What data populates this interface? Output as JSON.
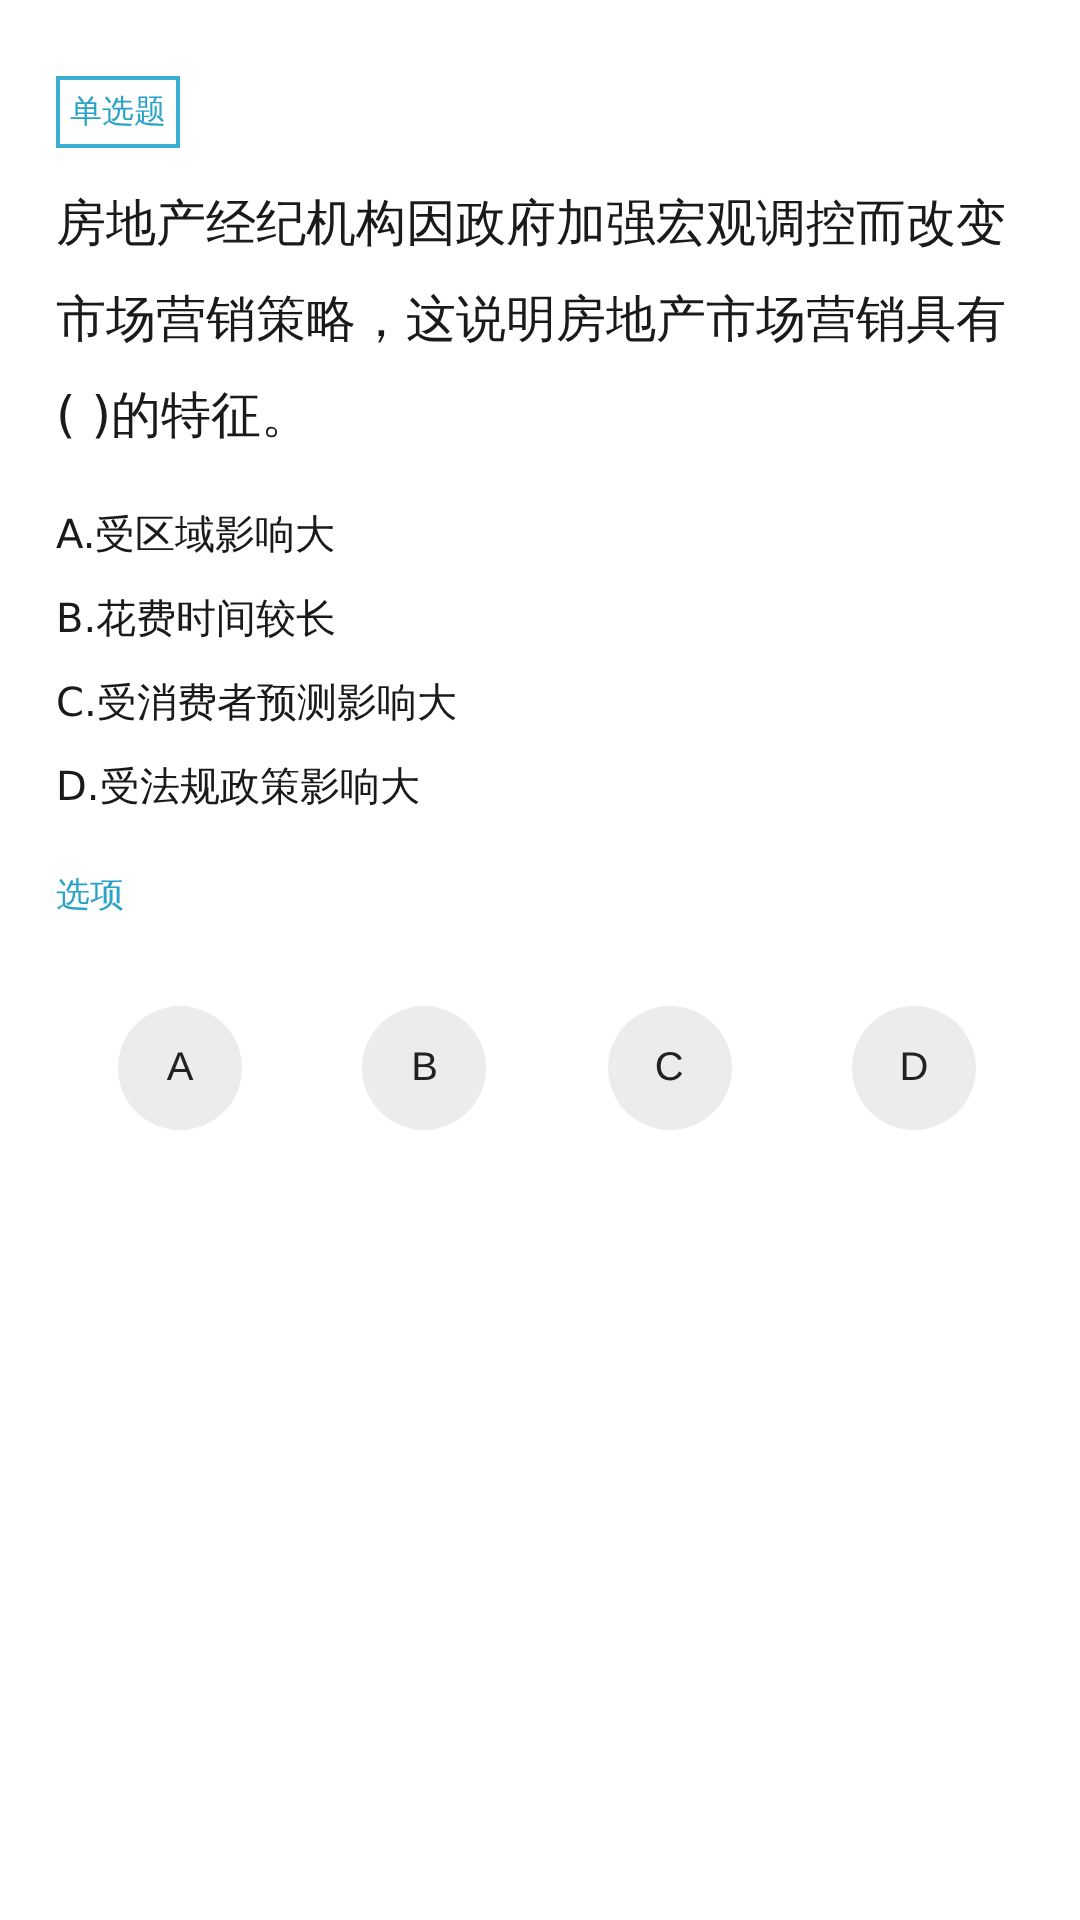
{
  "question_type": "单选题",
  "question": "房地产经纪机构因政府加强宏观调控而改变市场营销策略，这说明房地产市场营销具有( )的特征。",
  "options": [
    "A.受区域影响大",
    "B.花费时间较长",
    "C.受消费者预测影响大",
    "D.受法规政策影响大"
  ],
  "answer_label": "选项",
  "answers": [
    {
      "label": "A",
      "selected": false
    },
    {
      "label": "B",
      "selected": false
    },
    {
      "label": "C",
      "selected": false
    },
    {
      "label": "D",
      "selected": false
    }
  ]
}
